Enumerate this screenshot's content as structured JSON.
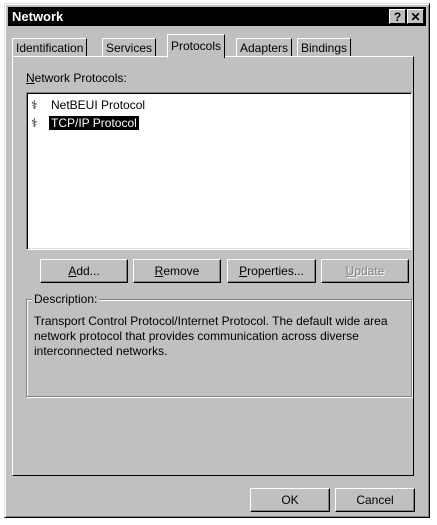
{
  "window": {
    "title": "Network",
    "help_label": "?",
    "close_label": "✕"
  },
  "tabs": [
    {
      "label": "Identification"
    },
    {
      "label": "Services"
    },
    {
      "label": "Protocols"
    },
    {
      "label": "Adapters"
    },
    {
      "label": "Bindings"
    }
  ],
  "active_tab": "Protocols",
  "protocols": {
    "label_prefix": "N",
    "label_rest": "etwork Protocols:",
    "items": [
      {
        "label": "NetBEUI Protocol",
        "icon": "network-protocol-icon",
        "selected": false
      },
      {
        "label": "TCP/IP Protocol",
        "icon": "network-protocol-icon",
        "selected": true
      }
    ]
  },
  "buttons": {
    "add": {
      "accel": "A",
      "rest": "dd..."
    },
    "remove": {
      "accel": "R",
      "rest": "emove"
    },
    "properties": {
      "accel": "P",
      "rest": "roperties..."
    },
    "update": {
      "accel": "U",
      "rest": "pdate",
      "disabled": true
    }
  },
  "description": {
    "title": "Description:",
    "text": "Transport Control Protocol/Internet Protocol. The default wide area network protocol that provides communication across diverse interconnected networks."
  },
  "footer": {
    "ok_label": "OK",
    "cancel_label": "Cancel"
  }
}
